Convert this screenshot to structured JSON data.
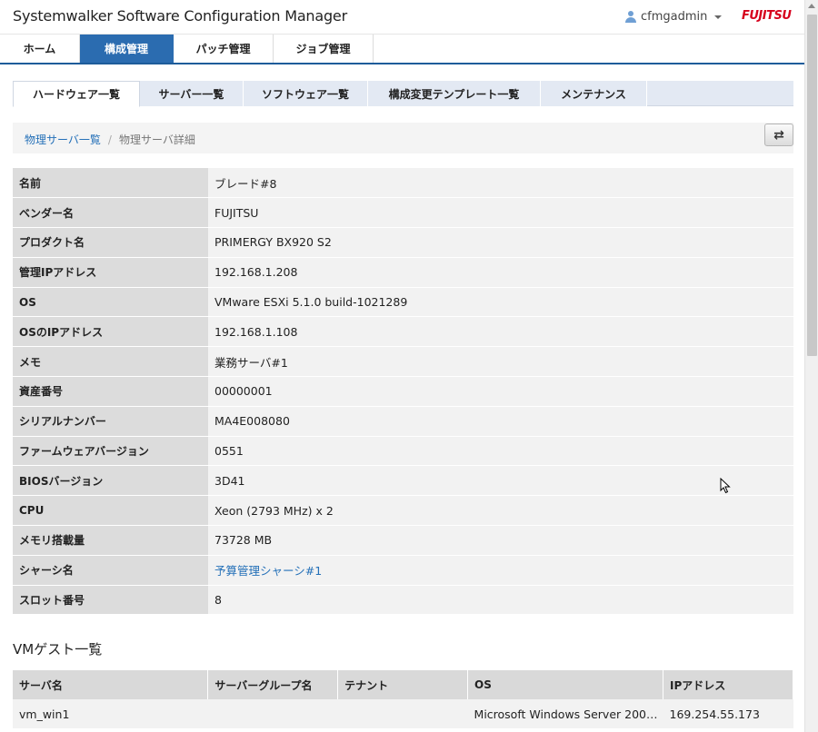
{
  "header": {
    "app_title": "Systemwalker Software Configuration Manager",
    "user_name": "cfmgadmin",
    "brand": "FUJITSU"
  },
  "main_nav": {
    "items": [
      {
        "label": "ホーム",
        "active": false
      },
      {
        "label": "構成管理",
        "active": true
      },
      {
        "label": "パッチ管理",
        "active": false
      },
      {
        "label": "ジョブ管理",
        "active": false
      }
    ]
  },
  "sub_tabs": {
    "items": [
      {
        "label": "ハードウェア一覧",
        "active": true
      },
      {
        "label": "サーバー一覧",
        "active": false
      },
      {
        "label": "ソフトウェア一覧",
        "active": false
      },
      {
        "label": "構成変更テンプレート一覧",
        "active": false
      },
      {
        "label": "メンテナンス",
        "active": false
      }
    ]
  },
  "breadcrumb": {
    "parent": "物理サーバ一覧",
    "separator": "/",
    "current": "物理サーバ詳細"
  },
  "details": {
    "rows": [
      {
        "label": "名前",
        "value": "ブレード#8"
      },
      {
        "label": "ベンダー名",
        "value": "FUJITSU"
      },
      {
        "label": "プロダクト名",
        "value": "PRIMERGY BX920 S2"
      },
      {
        "label": "管理IPアドレス",
        "value": "192.168.1.208"
      },
      {
        "label": "OS",
        "value": "VMware ESXi 5.1.0 build-1021289"
      },
      {
        "label": "OSのIPアドレス",
        "value": "192.168.1.108"
      },
      {
        "label": "メモ",
        "value": "業務サーバ#1"
      },
      {
        "label": "資産番号",
        "value": "00000001"
      },
      {
        "label": "シリアルナンバー",
        "value": "MA4E008080"
      },
      {
        "label": "ファームウェアバージョン",
        "value": "0551"
      },
      {
        "label": "BIOSバージョン",
        "value": "3D41"
      },
      {
        "label": "CPU",
        "value": "Xeon (2793 MHz) x 2"
      },
      {
        "label": "メモリ搭載量",
        "value": "73728 MB"
      },
      {
        "label": "シャーシ名",
        "value": "予算管理シャーシ#1",
        "link": true
      },
      {
        "label": "スロット番号",
        "value": "8"
      }
    ]
  },
  "vm_section": {
    "title": "VMゲスト一覧",
    "columns": [
      "サーバ名",
      "サーバーグループ名",
      "テナント",
      "OS",
      "IPアドレス"
    ],
    "rows": [
      [
        "vm_win1",
        "",
        "",
        "Microsoft Windows Server 200…",
        "169.254.55.173"
      ]
    ]
  }
}
